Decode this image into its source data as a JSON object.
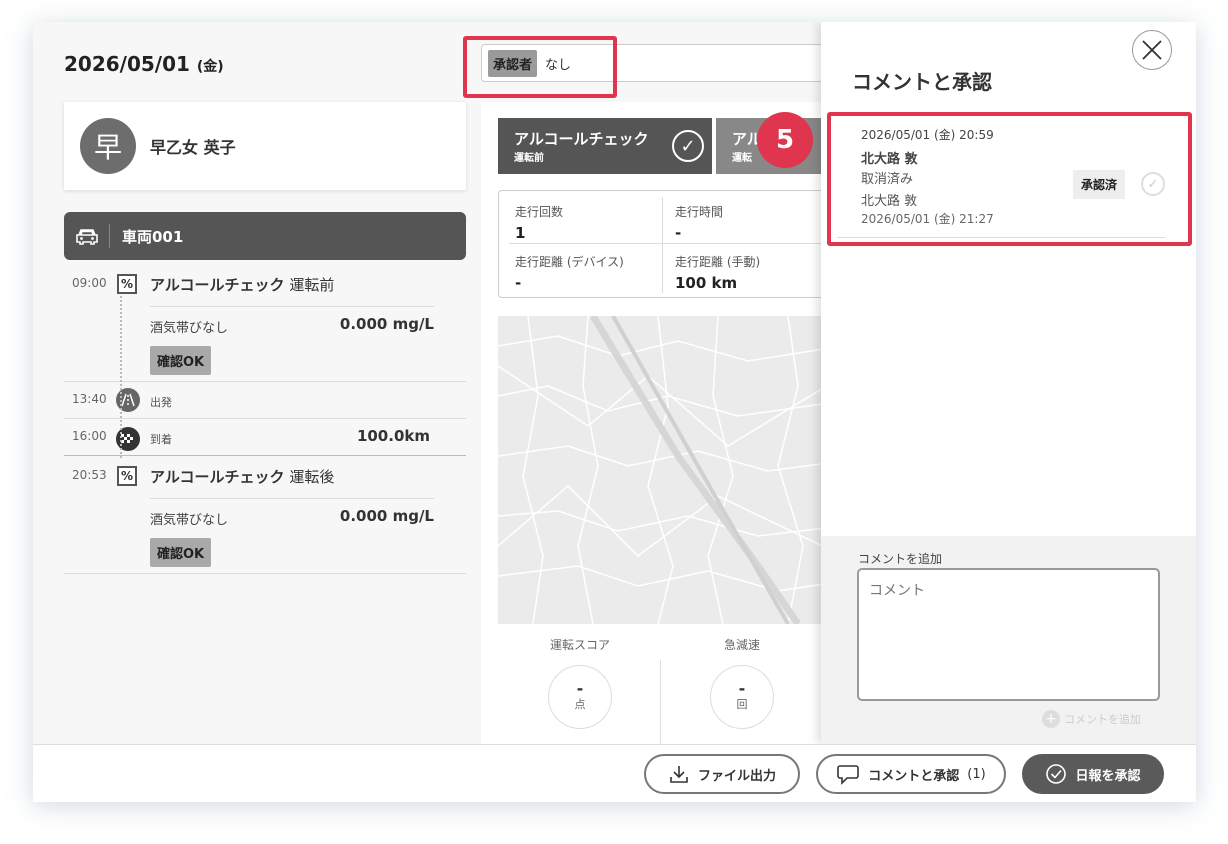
{
  "header": {
    "date": "2026/05/01",
    "weekday": "(金)"
  },
  "approver": {
    "label": "承認者",
    "value": "なし"
  },
  "user": {
    "initial": "早",
    "name": "早乙女 英子"
  },
  "vehicle": {
    "name": "車両001"
  },
  "timeline": {
    "check1": {
      "time": "09:00",
      "title": "アルコールチェック",
      "phase": "運転前",
      "key": "酒気帯びなし",
      "value": "0.000 mg/L",
      "badge": "確認OK"
    },
    "depart": {
      "time": "13:40",
      "label": "出発"
    },
    "arrive": {
      "time": "16:00",
      "label": "到着",
      "distance": "100.0km"
    },
    "check2": {
      "time": "20:53",
      "title": "アルコールチェック",
      "phase": "運転後",
      "key": "酒気帯びなし",
      "value": "0.000 mg/L",
      "badge": "確認OK"
    }
  },
  "tabs": {
    "first": {
      "title": "アルコールチェック",
      "sub": "運転前"
    },
    "second": {
      "title": "アル",
      "sub": "運転"
    }
  },
  "step_badge": "5",
  "stats": {
    "runs": {
      "label": "走行回数",
      "value": "1"
    },
    "time": {
      "label": "走行時間",
      "value": "-"
    },
    "dist_device": {
      "label": "走行距離 (デバイス)",
      "value": "-"
    },
    "dist_manual": {
      "label": "走行距離 (手動)",
      "value": "100 km"
    }
  },
  "scores": {
    "drive": {
      "label": "運転スコア",
      "value": "-",
      "unit": "点"
    },
    "brake": {
      "label": "急減速",
      "value": "-",
      "unit": "回"
    }
  },
  "panel": {
    "title": "コメントと承認",
    "comment": {
      "date": "2026/05/01 (金) 20:59",
      "author": "北大路 敦",
      "text": "取消済み",
      "by": "北大路 敦",
      "date2": "2026/05/01 (金) 21:27",
      "status": "承認済"
    },
    "add_label": "コメントを追加",
    "placeholder": "コメント",
    "add_button": "コメントを追加"
  },
  "footer": {
    "export": "ファイル出力",
    "comments": "コメントと承認",
    "comments_count": "(1)",
    "approve": "日報を承認"
  },
  "colors": {
    "highlight": "#e0354e",
    "dark": "#555555",
    "badge": "#a9a9a9"
  }
}
